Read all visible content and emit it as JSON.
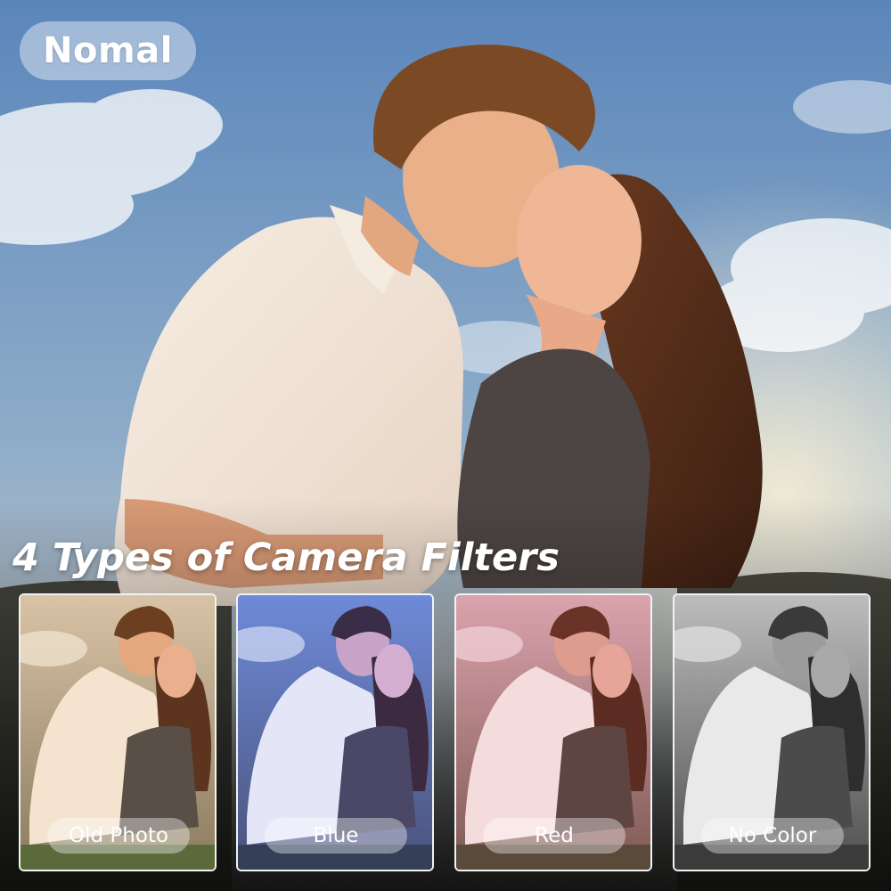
{
  "mode_badge": {
    "label": "Nomal"
  },
  "headline": {
    "text": "4 Types of Camera Filters"
  },
  "filters": [
    {
      "label": "Old Photo",
      "tint": "#e8c79a"
    },
    {
      "label": "Blue",
      "tint": "#8fa6e8"
    },
    {
      "label": "Red",
      "tint": "#e8a3b0"
    },
    {
      "label": "No Color",
      "tint": "#b8b8b8"
    }
  ],
  "colors": {
    "sky_top": "#5d86b9",
    "sky_bottom": "#a9bfd3",
    "ground": "#2d2f24"
  }
}
